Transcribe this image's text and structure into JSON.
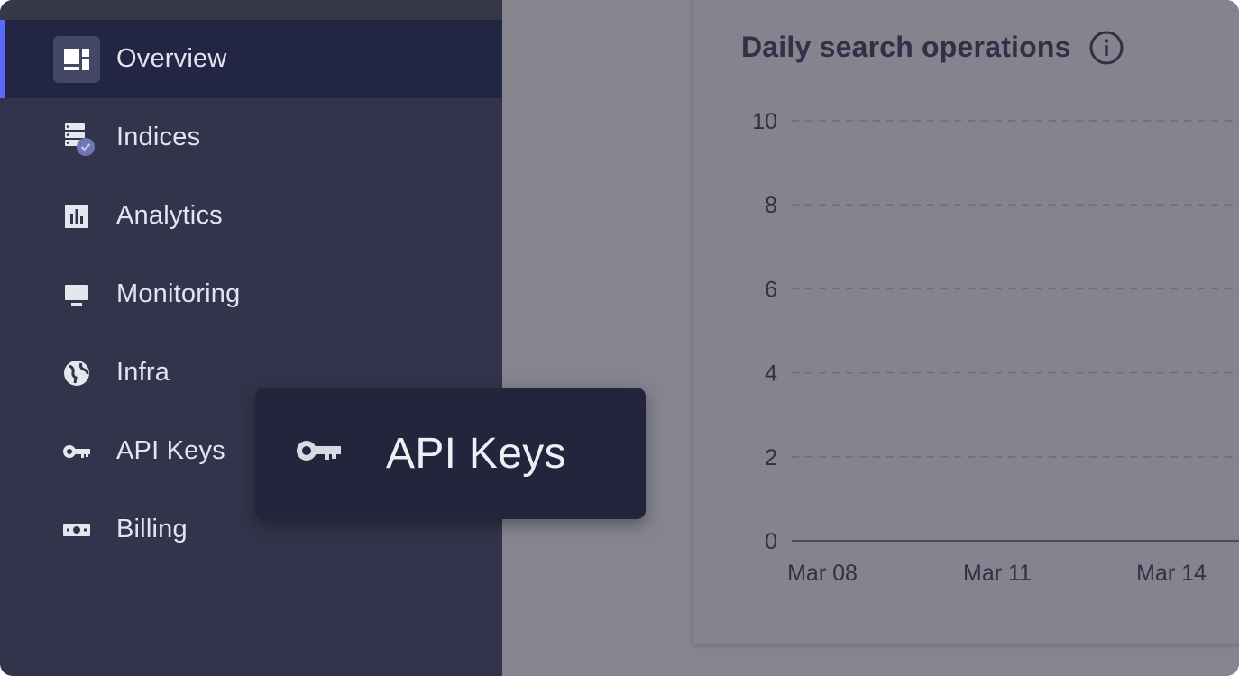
{
  "sidebar": {
    "items": [
      {
        "label": "Overview",
        "icon": "dashboard-icon",
        "active": true
      },
      {
        "label": "Indices",
        "icon": "indices-icon",
        "active": false
      },
      {
        "label": "Analytics",
        "icon": "bar-chart-icon",
        "active": false
      },
      {
        "label": "Monitoring",
        "icon": "monitor-icon",
        "active": false
      },
      {
        "label": "Infra",
        "icon": "globe-icon",
        "active": false
      },
      {
        "label": "API Keys",
        "icon": "key-icon",
        "active": false
      },
      {
        "label": "Billing",
        "icon": "billing-icon",
        "active": false
      }
    ]
  },
  "tooltip": {
    "label": "API Keys",
    "icon": "key-icon"
  },
  "main": {
    "chart_title": "Daily search operations",
    "info_icon": "info-icon"
  },
  "colors": {
    "accent": "#5a68ff",
    "sidebar_bg": "#32344b",
    "active_bg": "#222543",
    "overlay_bg": "#85848f"
  },
  "chart_data": {
    "type": "line",
    "title": "Daily search operations",
    "x": [
      "Mar 08",
      "Mar 11",
      "Mar 14"
    ],
    "y_ticks": [
      0,
      2,
      4,
      6,
      8,
      10
    ],
    "ylim": [
      0,
      10
    ],
    "series": [
      {
        "values": [
          0,
          0,
          0
        ]
      }
    ],
    "grid": true
  }
}
